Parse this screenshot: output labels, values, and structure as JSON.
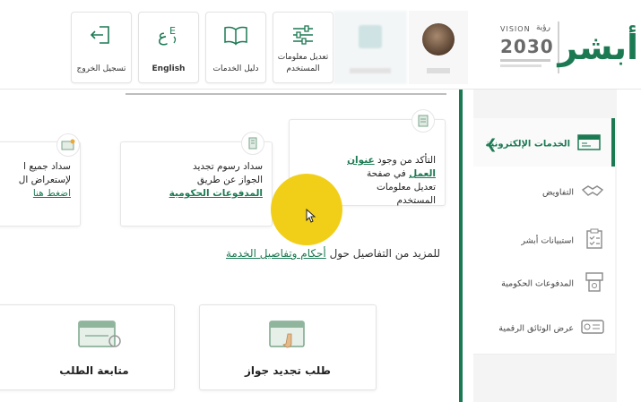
{
  "header": {
    "buttons": [
      {
        "label": "تسجيل الخروج",
        "icon": "logout-icon"
      },
      {
        "label": "English",
        "icon": "language-icon"
      },
      {
        "label": "دليل الخدمات",
        "icon": "book-icon"
      },
      {
        "label": "تعديل معلومات المستخدم",
        "icon": "sliders-icon"
      }
    ],
    "logo": {
      "brand": "أبشر",
      "vision_label": "VISION",
      "vision_year": "2030",
      "vision_arabic": "رؤية"
    }
  },
  "cards": [
    {
      "line1": "التأكد من وجود",
      "link1": "عنوان",
      "link2": "العمل",
      "line2": "في صفحة",
      "line3": "تعديل معلومات",
      "line4": "المستخدم",
      "icon": "checklist-icon"
    },
    {
      "line1": "سداد رسوم تجديد",
      "line2": "الجواز عن طريق",
      "link1": "المدفوعات الحكومية",
      "icon": "atm-icon"
    },
    {
      "line1": "سداد جميع ا",
      "line2": "لإستعراض ال",
      "link1": "اضغط هنا",
      "icon": "money-icon"
    }
  ],
  "more_info": {
    "text": "للمزيد من التفاصيل حول",
    "link": "أحكام وتفاصيل الخدمة"
  },
  "actions": [
    {
      "label": "طلب تجديد جواز",
      "icon": "renew-passport-icon"
    },
    {
      "label": "متابعة الطلب",
      "icon": "track-request-icon"
    }
  ],
  "sidebar": {
    "items": [
      {
        "label": "الخدمات الإلكترونية",
        "icon": "eservices-icon",
        "active": true
      },
      {
        "label": "التفاويض",
        "icon": "handshake-icon",
        "active": false
      },
      {
        "label": "استبيانات أبشر",
        "icon": "survey-icon",
        "active": false
      },
      {
        "label": "المدفوعات الحكومية",
        "icon": "payments-icon",
        "active": false
      },
      {
        "label": "عرض الوثائق الرقمية",
        "icon": "documents-icon",
        "active": false
      }
    ]
  },
  "colors": {
    "brand": "#1c7a53",
    "pointer": "#f1cf19"
  }
}
